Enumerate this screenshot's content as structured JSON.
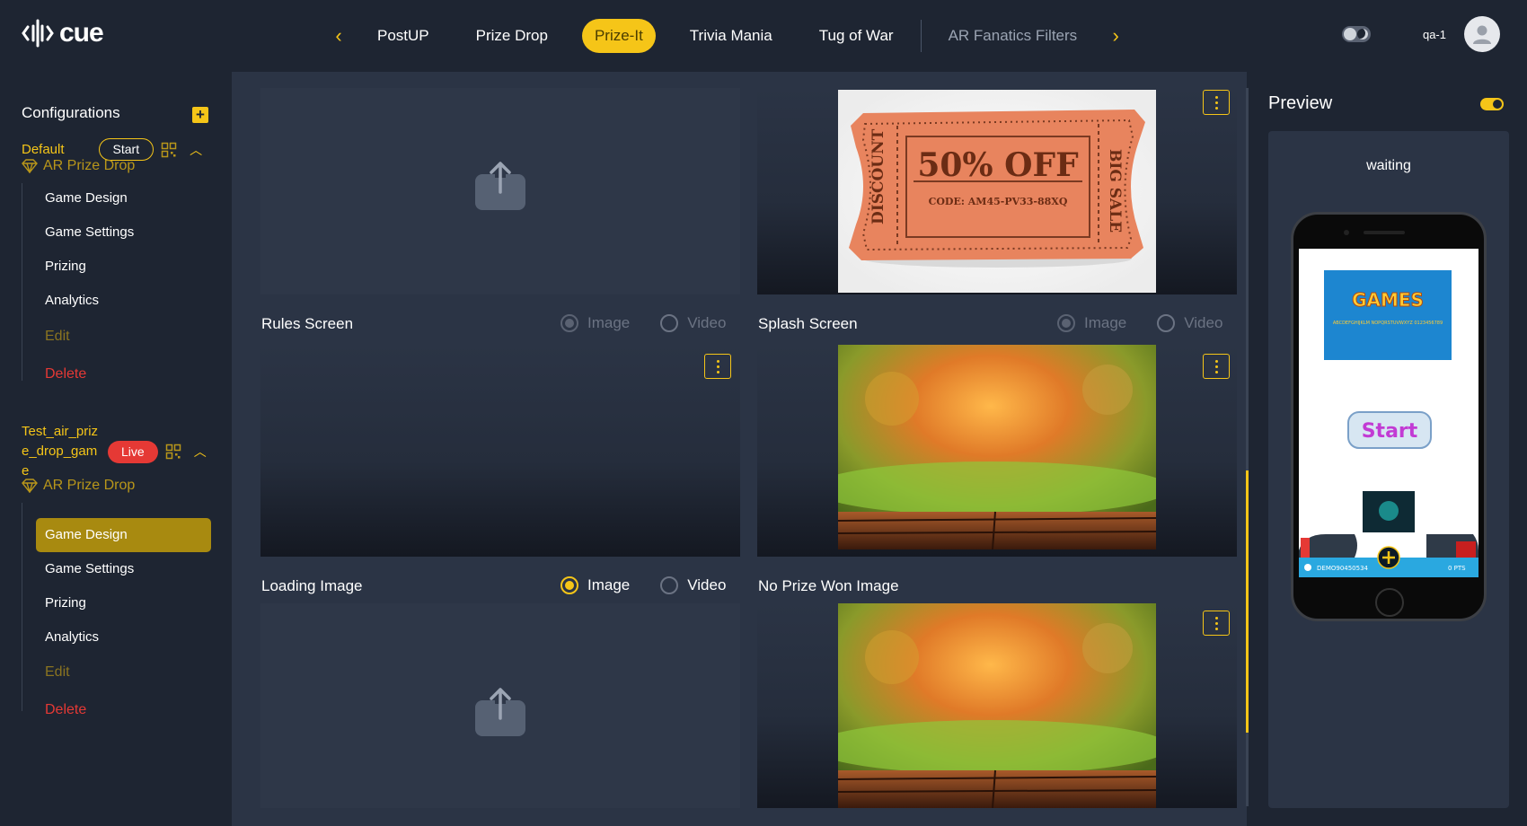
{
  "app": {
    "logo_text": "cue"
  },
  "nav": {
    "tabs": [
      {
        "label": "PostUP"
      },
      {
        "label": "Prize Drop"
      },
      {
        "label": "Prize-It"
      },
      {
        "label": "Trivia Mania"
      },
      {
        "label": "Tug of War"
      },
      {
        "label": "AR Fanatics Filters"
      }
    ],
    "active_tab": "Prize-It"
  },
  "user": {
    "name": "qa-1"
  },
  "sidebar": {
    "title": "Configurations",
    "configs": [
      {
        "name": "Default",
        "status": "Start",
        "game": "AR Prize Drop",
        "items": [
          "Game Design",
          "Game Settings",
          "Prizing",
          "Analytics",
          "Edit",
          "Delete"
        ]
      },
      {
        "name_lines": [
          "Test_air_priz",
          "e_drop_gam",
          "e"
        ],
        "status": "Live",
        "game": "AR Prize Drop",
        "items": [
          "Game Design",
          "Game Settings",
          "Prizing",
          "Analytics",
          "Edit",
          "Delete"
        ],
        "active_item": "Game Design"
      }
    ]
  },
  "main": {
    "coupon": {
      "main": "50% OFF",
      "code": "CODE: AM45-PV33-88XQ",
      "left": "DISCOUNT",
      "right": "BIG SALE"
    },
    "rules_screen": {
      "label": "Rules Screen",
      "opt_image": "Image",
      "opt_video": "Video"
    },
    "splash_screen": {
      "label": "Splash Screen",
      "opt_image": "Image",
      "opt_video": "Video"
    },
    "loading_image": {
      "label": "Loading Image",
      "opt_image": "Image",
      "opt_video": "Video",
      "selected": "Image"
    },
    "no_prize_won": {
      "label": "No Prize Won Image"
    }
  },
  "preview": {
    "title": "Preview",
    "status": "waiting",
    "phone": {
      "games_title": "GAMES",
      "games_sub": "ABCDEFGHIJKLM NOPQRSTUVWXYZ 0123456789",
      "start_label": "Start",
      "footer_text": "DEMO90450534",
      "points": "0 PTS"
    }
  }
}
